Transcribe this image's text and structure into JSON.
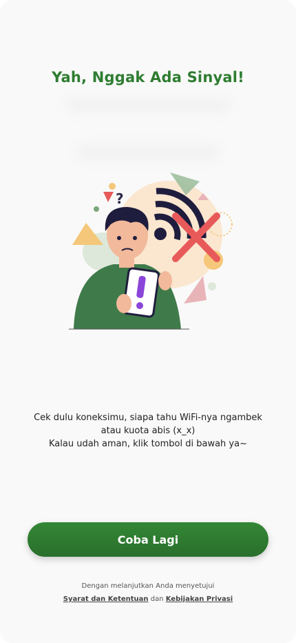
{
  "header": {
    "title": "Yah, Nggak Ada Sinyal!"
  },
  "message": {
    "line1": "Cek dulu koneksimu, siapa tahu WiFi-nya ngambek",
    "line2": "atau kuota abis (x_x)",
    "line3": "Kalau udah aman, klik tombol di bawah ya~"
  },
  "actions": {
    "retry_label": "Coba Lagi"
  },
  "footer": {
    "prefix": "Dengan melanjutkan Anda menyetujui",
    "terms_link": "Syarat dan Ketentuan",
    "conjunction": "dan",
    "privacy_link": "Kebijakan Privasi"
  },
  "colors": {
    "accent": "#2f7d32",
    "error": "#e85a5a"
  }
}
